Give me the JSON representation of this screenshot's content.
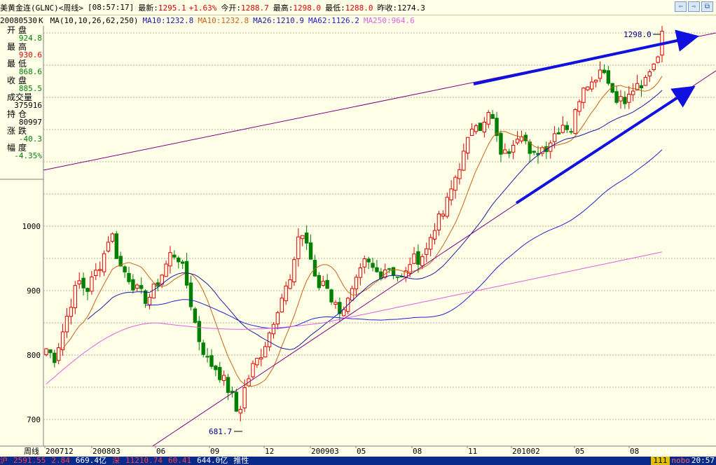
{
  "topbar": {
    "title": "美黄金连(GLNC)<周线>",
    "time": "[08:57:17]",
    "latest_label": "最新:",
    "latest_value": "1295.1",
    "change": "+1.63%",
    "open_label": "今开:",
    "open_value": "1288.7",
    "high_label": "最高:",
    "high_value": "1298.0",
    "low_label": "最低:",
    "low_value": "1288.0",
    "prevclose_label": "昨收:",
    "prevclose_value": "1274.3"
  },
  "mabar": {
    "date": "20080530",
    "k": "K",
    "params": "MA(10,10,26,62,250)",
    "ma10a": "MA10:1232.8",
    "ma10b": "MA10:1232.8",
    "ma26": "MA26:1210.9",
    "ma62": "MA62:1126.2",
    "ma250": "MA250:964.6"
  },
  "panel": {
    "open_label": "开盘",
    "open_value": "924.8",
    "high_label": "最高",
    "high_value": "930.6",
    "low_label": "最低",
    "low_value": "868.6",
    "close_label": "收盘",
    "close_value": "885.5",
    "volume_label": "成交量",
    "volume_value": "375916",
    "position_label": "持仓",
    "position_value": "80997",
    "change_label": "涨跌",
    "change_value": "-40.3",
    "pct_label": "幅度",
    "pct_value": "-4.35%"
  },
  "chart": {
    "y_ticks": [
      "1000",
      "900",
      "800",
      "700"
    ],
    "x_ticks": [
      "200712",
      "200803",
      "06",
      "09",
      "12",
      "200903",
      "05",
      "08",
      "11",
      "201002",
      "05",
      "08"
    ],
    "axis_title": "周线",
    "high_annotation": "1298.0",
    "low_annotation": "681.7"
  },
  "statusbar": {
    "sh_label": "沪",
    "sh_value": "2591.55",
    "sh_change": "2.84",
    "sh_amount": "669.4亿",
    "sz_label": "深",
    "sz_value": "11210.74",
    "sz_change": "60.41",
    "sz_amount": "644.0亿",
    "extra": "推性",
    "right_badge": "111",
    "right_brand": "nobo",
    "clock": "20:57"
  },
  "colors": {
    "up": "#e00000",
    "down": "#008000",
    "ma10": "#c86414",
    "ma26": "#1a1aa0",
    "ma62": "#2020d0",
    "ma250": "#e060e0",
    "trend": "#800080",
    "arrow": "#1010e0"
  }
}
